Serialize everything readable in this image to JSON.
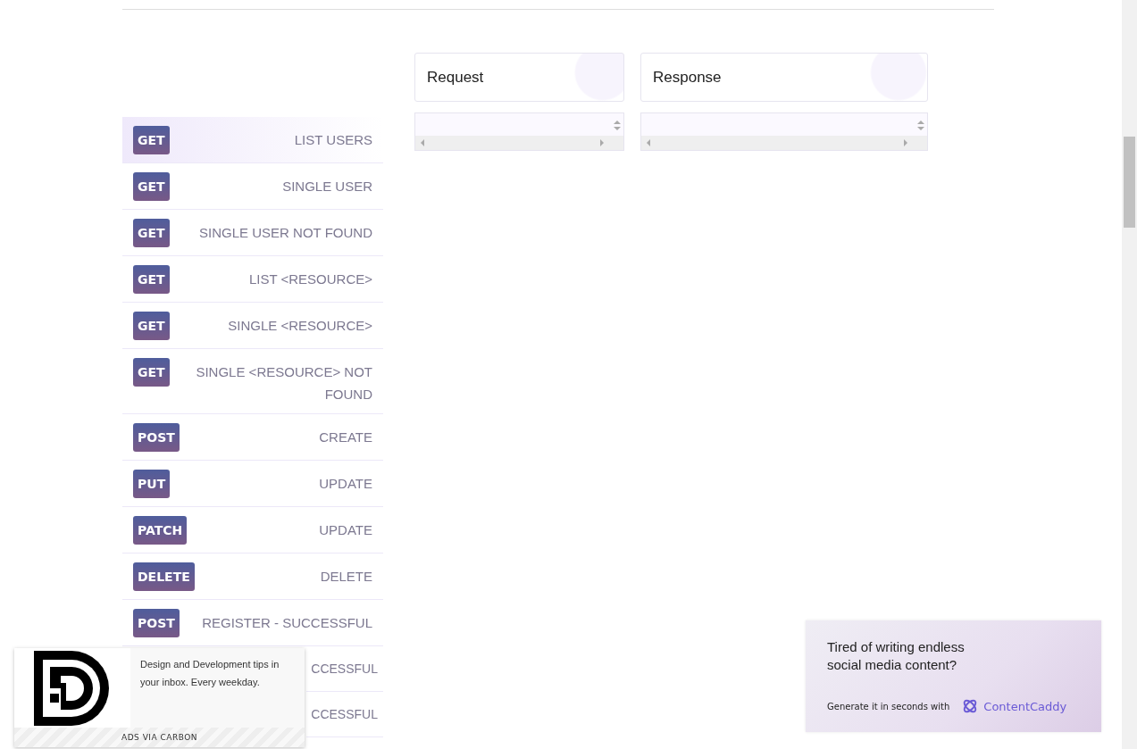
{
  "endpoints": [
    {
      "method": "GET",
      "label": "LIST USERS",
      "selected": true
    },
    {
      "method": "GET",
      "label": "SINGLE USER",
      "selected": false
    },
    {
      "method": "GET",
      "label": "SINGLE USER NOT FOUND",
      "selected": false
    },
    {
      "method": "GET",
      "label": "LIST <RESOURCE>",
      "selected": false
    },
    {
      "method": "GET",
      "label": "SINGLE <RESOURCE>",
      "selected": false
    },
    {
      "method": "GET",
      "label": "SINGLE <RESOURCE> NOT FOUND",
      "selected": false
    },
    {
      "method": "POST",
      "label": "CREATE",
      "selected": false
    },
    {
      "method": "PUT",
      "label": "UPDATE",
      "selected": false
    },
    {
      "method": "PATCH",
      "label": "UPDATE",
      "selected": false
    },
    {
      "method": "DELETE",
      "label": "DELETE",
      "selected": false
    },
    {
      "method": "POST",
      "label": "REGISTER - SUCCESSFUL",
      "selected": false
    },
    {
      "kind": "partial",
      "label": "CCESSFUL",
      "selected": false
    },
    {
      "kind": "partial",
      "label": "CCESSFUL",
      "selected": false
    }
  ],
  "request": {
    "title": "Request"
  },
  "response": {
    "title": "Response"
  },
  "carbon_ad": {
    "text": "Design and Development tips in your inbox. Every weekday.",
    "footer": "ADS VIA CARBON"
  },
  "promo_ad": {
    "headline": "Tired of writing endless social media content?",
    "tagline": "Generate it in seconds with",
    "brand": "ContentCaddy"
  }
}
